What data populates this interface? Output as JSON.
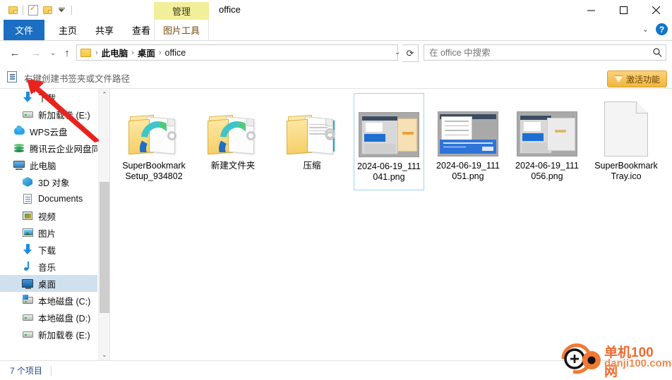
{
  "window": {
    "title": "office",
    "minimize_label": "—",
    "maximize_label": "▫",
    "close_label": "✕"
  },
  "quick_access": {
    "items": [
      {
        "name": "folder-icon",
        "label": ""
      },
      {
        "name": "properties-icon",
        "label": ""
      },
      {
        "name": "new-folder-icon",
        "label": ""
      },
      {
        "name": "customize-dropdown",
        "label": ""
      }
    ]
  },
  "ribbon": {
    "tabs": [
      {
        "id": "file",
        "label": "文件"
      },
      {
        "id": "home",
        "label": "主页"
      },
      {
        "id": "share",
        "label": "共享"
      },
      {
        "id": "view",
        "label": "查看"
      }
    ],
    "contextual": {
      "group_title": "管理",
      "tab_label": "图片工具"
    },
    "collapse_label": "⌄",
    "help_label": "?"
  },
  "address_bar": {
    "back_label": "←",
    "forward_label": "→",
    "history_label": "⌄",
    "up_label": "↑",
    "breadcrumbs": [
      "此电脑",
      "桌面",
      "office"
    ],
    "separator": "›",
    "dropdown_label": "⌄",
    "refresh_label": "⟳"
  },
  "search": {
    "placeholder": "在 office 中搜索",
    "value": "",
    "icon": "search-icon"
  },
  "bookmark_bar": {
    "hint_text": "右键创建书签夹或文件路径",
    "icon": "bookmark-icon"
  },
  "activate_button": {
    "label": "激活功能",
    "icon": "gem-icon",
    "color": "#f0b63f"
  },
  "sidebar": {
    "items": [
      {
        "label": "下载",
        "icon": "download-icon",
        "indent": 1,
        "selected": false
      },
      {
        "label": "新加载卷 (E:)",
        "icon": "drive-icon",
        "indent": 1,
        "selected": false
      },
      {
        "label": "WPS云盘",
        "icon": "cloud-icon",
        "indent": 0,
        "selected": false
      },
      {
        "label": "腾讯云企业网盘同",
        "icon": "tencent-cloud-icon",
        "indent": 0,
        "selected": false
      },
      {
        "label": "此电脑",
        "icon": "this-pc-icon",
        "indent": 0,
        "selected": false
      },
      {
        "label": "3D 对象",
        "icon": "3d-objects-icon",
        "indent": 1,
        "selected": false
      },
      {
        "label": "Documents",
        "icon": "documents-icon",
        "indent": 1,
        "selected": false
      },
      {
        "label": "视频",
        "icon": "videos-icon",
        "indent": 1,
        "selected": false
      },
      {
        "label": "图片",
        "icon": "pictures-icon",
        "indent": 1,
        "selected": false
      },
      {
        "label": "下载",
        "icon": "download-icon",
        "indent": 1,
        "selected": false
      },
      {
        "label": "音乐",
        "icon": "music-icon",
        "indent": 1,
        "selected": false
      },
      {
        "label": "桌面",
        "icon": "desktop-icon",
        "indent": 1,
        "selected": true
      },
      {
        "label": "本地磁盘 (C:)",
        "icon": "system-drive-icon",
        "indent": 1,
        "selected": false
      },
      {
        "label": "本地磁盘 (D:)",
        "icon": "drive-icon",
        "indent": 1,
        "selected": false
      },
      {
        "label": "新加载卷 (E:)",
        "icon": "drive-icon",
        "indent": 1,
        "selected": false
      }
    ],
    "scroll_up_label": "⌃",
    "scroll_down_label": "⌄"
  },
  "files": [
    {
      "name": "SuperBookmarkSetup_934802",
      "type": "folder-edge",
      "selected": false
    },
    {
      "name": "新建文件夹",
      "type": "folder-edge",
      "selected": false
    },
    {
      "name": "压缩",
      "type": "folder-doc",
      "selected": false
    },
    {
      "name": "2024-06-19_111041.png",
      "type": "image-a",
      "selected": true
    },
    {
      "name": "2024-06-19_111051.png",
      "type": "image-b",
      "selected": false
    },
    {
      "name": "2024-06-19_111056.png",
      "type": "image-c",
      "selected": false
    },
    {
      "name": "SuperBookmarkTray.ico",
      "type": "ico",
      "selected": false
    }
  ],
  "status_bar": {
    "item_count": "7 个项目"
  },
  "watermark": {
    "line1": "单机100网",
    "line2": "danji100.com"
  }
}
